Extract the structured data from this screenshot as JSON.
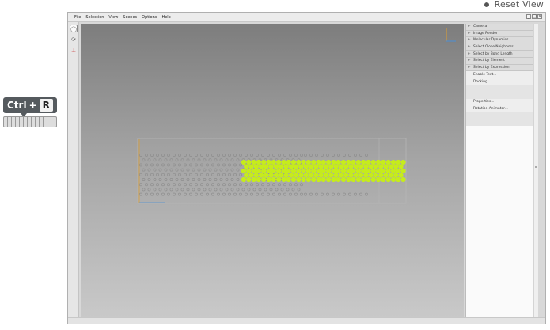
{
  "caption": {
    "text": "Reset View"
  },
  "shortcut": {
    "ctrl": "Ctrl",
    "plus": "+",
    "key": "R"
  },
  "menubar": {
    "items": [
      "File",
      "Selection",
      "View",
      "Scenes",
      "Options",
      "Help"
    ]
  },
  "window_controls": [
    "_",
    "▢",
    "✕"
  ],
  "toolbar": {
    "icons": [
      "camera-icon",
      "orbit-icon",
      "axes-icon"
    ]
  },
  "side_panel": {
    "rows": [
      {
        "label": "Camera",
        "kind": "header",
        "expander": "+"
      },
      {
        "label": "Image Render",
        "kind": "header",
        "expander": "+"
      },
      {
        "label": "Molecular Dynamics",
        "kind": "header",
        "expander": "+"
      },
      {
        "label": "Select Close Neighbors",
        "kind": "header",
        "expander": "+"
      },
      {
        "label": "Select by Bond Length",
        "kind": "header",
        "expander": "+"
      },
      {
        "label": "Select by Element",
        "kind": "header",
        "expander": "+"
      },
      {
        "label": "Select by Expression",
        "kind": "header",
        "expander": "+"
      },
      {
        "label": "Enable Text...",
        "kind": "action"
      },
      {
        "label": "Docking...",
        "kind": "action"
      },
      {
        "label": "",
        "kind": "disabled"
      },
      {
        "label": "",
        "kind": "disabled"
      },
      {
        "label": "Properties...",
        "kind": "action"
      },
      {
        "label": "Rotation Animator...",
        "kind": "action"
      },
      {
        "label": "",
        "kind": "disabled"
      },
      {
        "label": "",
        "kind": "disabled"
      }
    ]
  },
  "colors": {
    "selected_atoms": "#c6ec1b",
    "unselected_atoms": "#8f8f8f",
    "bounding_box": "#b6b6b6",
    "axis_x": "#4a8fd6",
    "axis_y": "#e0a030"
  }
}
